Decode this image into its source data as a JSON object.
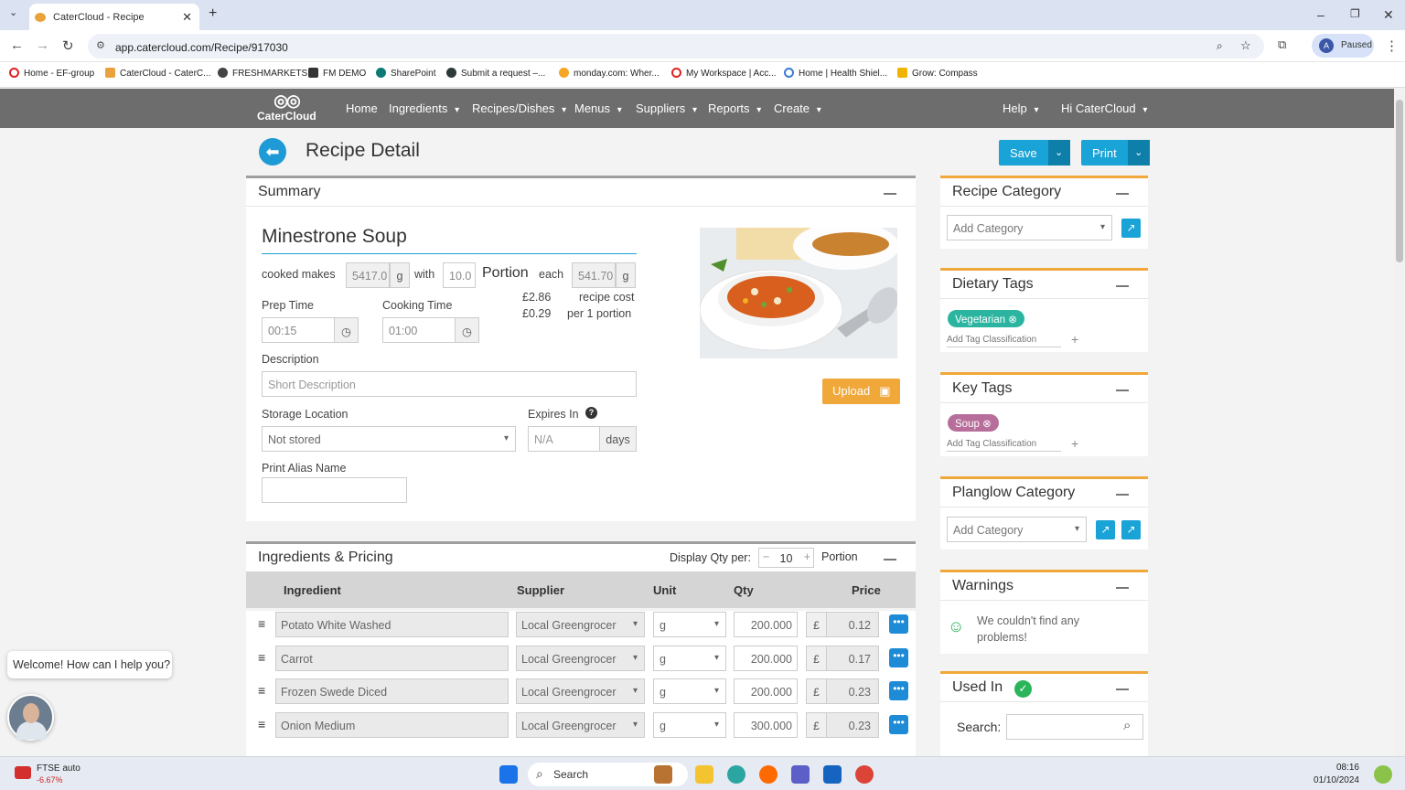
{
  "browser": {
    "tab_title": "CaterCloud - Recipe",
    "url": "app.catercloud.com/Recipe/917030",
    "profile_initial": "A",
    "profile_status": "Paused",
    "bookmarks": [
      "Home - EF-group",
      "CaterCloud - CaterC...",
      "FRESHMARKETS",
      "FM DEMO",
      "SharePoint",
      "Submit a request –...",
      "monday.com: Wher...",
      "My Workspace | Acc...",
      "Home | Health Shiel...",
      "Grow: Compass"
    ]
  },
  "nav": {
    "logo": "CaterCloud",
    "items": [
      "Home",
      "Ingredients",
      "Recipes/Dishes",
      "Menus",
      "Suppliers",
      "Reports",
      "Create"
    ],
    "help": "Help",
    "user": "Hi CaterCloud"
  },
  "page": {
    "title": "Recipe Detail",
    "save": "Save",
    "print": "Print"
  },
  "summary": {
    "panel_title": "Summary",
    "recipe_name": "Minestrone Soup",
    "cooked_makes_label": "cooked makes",
    "cooked_makes_value": "5417.0",
    "unit_g": "g",
    "with_label": "with",
    "portions_value": "10.0",
    "portion_label": "Portion",
    "each_label": "each",
    "each_value": "541.70",
    "recipe_cost": "£2.86",
    "recipe_cost_label": "recipe cost",
    "portion_cost": "£0.29",
    "portion_cost_label": "per 1 portion",
    "prep_time_label": "Prep Time",
    "prep_time": "00:15",
    "cooking_time_label": "Cooking Time",
    "cooking_time": "01:00",
    "description_label": "Description",
    "description_placeholder": "Short Description",
    "storage_label": "Storage Location",
    "storage_value": "Not stored",
    "expires_label": "Expires In",
    "expires_placeholder": "N/A",
    "days": "days",
    "print_alias_label": "Print Alias Name",
    "upload": "Upload"
  },
  "ingredients": {
    "panel_title": "Ingredients & Pricing",
    "display_qty_label": "Display Qty per:",
    "display_qty": "10",
    "portion": "Portion",
    "headers": [
      "Ingredient",
      "Supplier",
      "Unit",
      "Qty",
      "Price"
    ],
    "rows": [
      {
        "name": "Potato White Washed",
        "supplier": "Local Greengrocer",
        "unit": "g",
        "qty": "200.000",
        "currency": "£",
        "price": "0.12"
      },
      {
        "name": "Carrot",
        "supplier": "Local Greengrocer",
        "unit": "g",
        "qty": "200.000",
        "currency": "£",
        "price": "0.17"
      },
      {
        "name": "Frozen Swede Diced",
        "supplier": "Local Greengrocer",
        "unit": "g",
        "qty": "200.000",
        "currency": "£",
        "price": "0.23"
      },
      {
        "name": "Onion Medium",
        "supplier": "Local Greengrocer",
        "unit": "g",
        "qty": "300.000",
        "currency": "£",
        "price": "0.23"
      }
    ]
  },
  "sidebar": {
    "recipe_category": {
      "title": "Recipe Category",
      "placeholder": "Add Category"
    },
    "dietary_tags": {
      "title": "Dietary Tags",
      "tag": "Vegetarian",
      "add": "Add Tag Classification"
    },
    "key_tags": {
      "title": "Key Tags",
      "tag": "Soup",
      "add": "Add Tag Classification"
    },
    "planglow": {
      "title": "Planglow Category",
      "placeholder": "Add Category"
    },
    "warnings": {
      "title": "Warnings",
      "message": "We couldn't find any problems!"
    },
    "used_in": {
      "title": "Used In",
      "search_label": "Search:"
    }
  },
  "chat": {
    "message": "Welcome! How can I help you?"
  },
  "taskbar": {
    "stock_name": "FTSE auto",
    "stock_change": "-6.67%",
    "search": "Search",
    "time": "08:16",
    "date": "01/10/2024"
  },
  "colors": {
    "accent": "#1aa3d6",
    "orange": "#f0a83a",
    "vegetarian": "#2bb5a0",
    "soup": "#b76e9b",
    "nav": "#6d6d6d"
  }
}
